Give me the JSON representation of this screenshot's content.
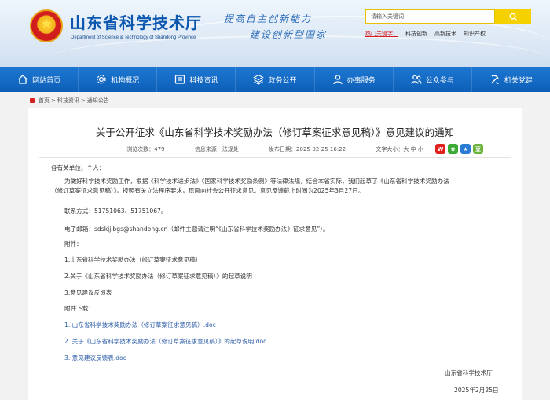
{
  "header": {
    "site_title": "山东省科学技术厅",
    "site_subtitle": "Department of Science & Technology of Shandong Province",
    "slogan_line1": "提高自主创新能力",
    "slogan_line2": "建设创新型国家",
    "search_placeholder": "请输入关键词",
    "hot_label": "热门关键字：",
    "hot_keywords": [
      "科技创新",
      "高新技术",
      "知识产权"
    ]
  },
  "nav": [
    {
      "label": "网站首页",
      "icon": "home-icon"
    },
    {
      "label": "机构概况",
      "icon": "gear-icon"
    },
    {
      "label": "科技资讯",
      "icon": "info-icon"
    },
    {
      "label": "政务公开",
      "icon": "layers-icon"
    },
    {
      "label": "办事服务",
      "icon": "service-icon"
    },
    {
      "label": "公众参与",
      "icon": "people-icon"
    },
    {
      "label": "机关党建",
      "icon": "party-icon"
    }
  ],
  "breadcrumb": {
    "home": "首页",
    "sep": ">",
    "section": "科技资讯",
    "current": "通知公告"
  },
  "article": {
    "title": "关于公开征求《山东省科学技术奖励办法（修订草案征求意见稿）》意见建议的通知",
    "views": "浏览次数：479",
    "source": "信息来源：法规处",
    "date": "发布日期：2025-02-25 16:22",
    "font_size": "文字大小：大 中 小",
    "greeting": "各有关单位、个人：",
    "para_line1": "为做好科学技术奖励工作，根据《科学技术进步法》《国家科学技术奖励条例》等法律法规，结合本省实际，我们起草了《山东省科学技术奖励办法",
    "para_line2": "（修订草案征求意见稿）》。按照有关立法程序要求，现面向社会公开征求意见。意见反馈截止时间为2025年3月27日。",
    "phone": "联系方式：51751063、51751067。",
    "email": "电子邮箱：sdskjjlbgs@shandong.cn（邮件主题请注明“《山东省科学技术奖励办法》征求意见”）。",
    "attach_label": "附件：",
    "attach1": "1.山东省科学技术奖励办法（修订草案征求意见稿）",
    "attach2": "2.关于《山东省科学技术奖励办法（修订草案征求意见稿）》的起草说明",
    "attach3": "3.意见建议反馈表",
    "download_label": "附件下载：",
    "download1": "1. 山东省科学技术奖励办法（修订草案征求意见稿）.doc",
    "download2": "2. 关于《山东省科学技术奖励办法（修订草案征求意见稿）》的起草说明.doc",
    "download3": "3. 意见建议反馈表.doc",
    "signer": "山东省科学技术厅",
    "sign_date": "2025年2月25日"
  },
  "colors": {
    "nav_blue": "#0d5fb8",
    "accent_red": "#d42020",
    "link_blue": "#2d5ea8",
    "search_yellow": "#f5d100"
  }
}
